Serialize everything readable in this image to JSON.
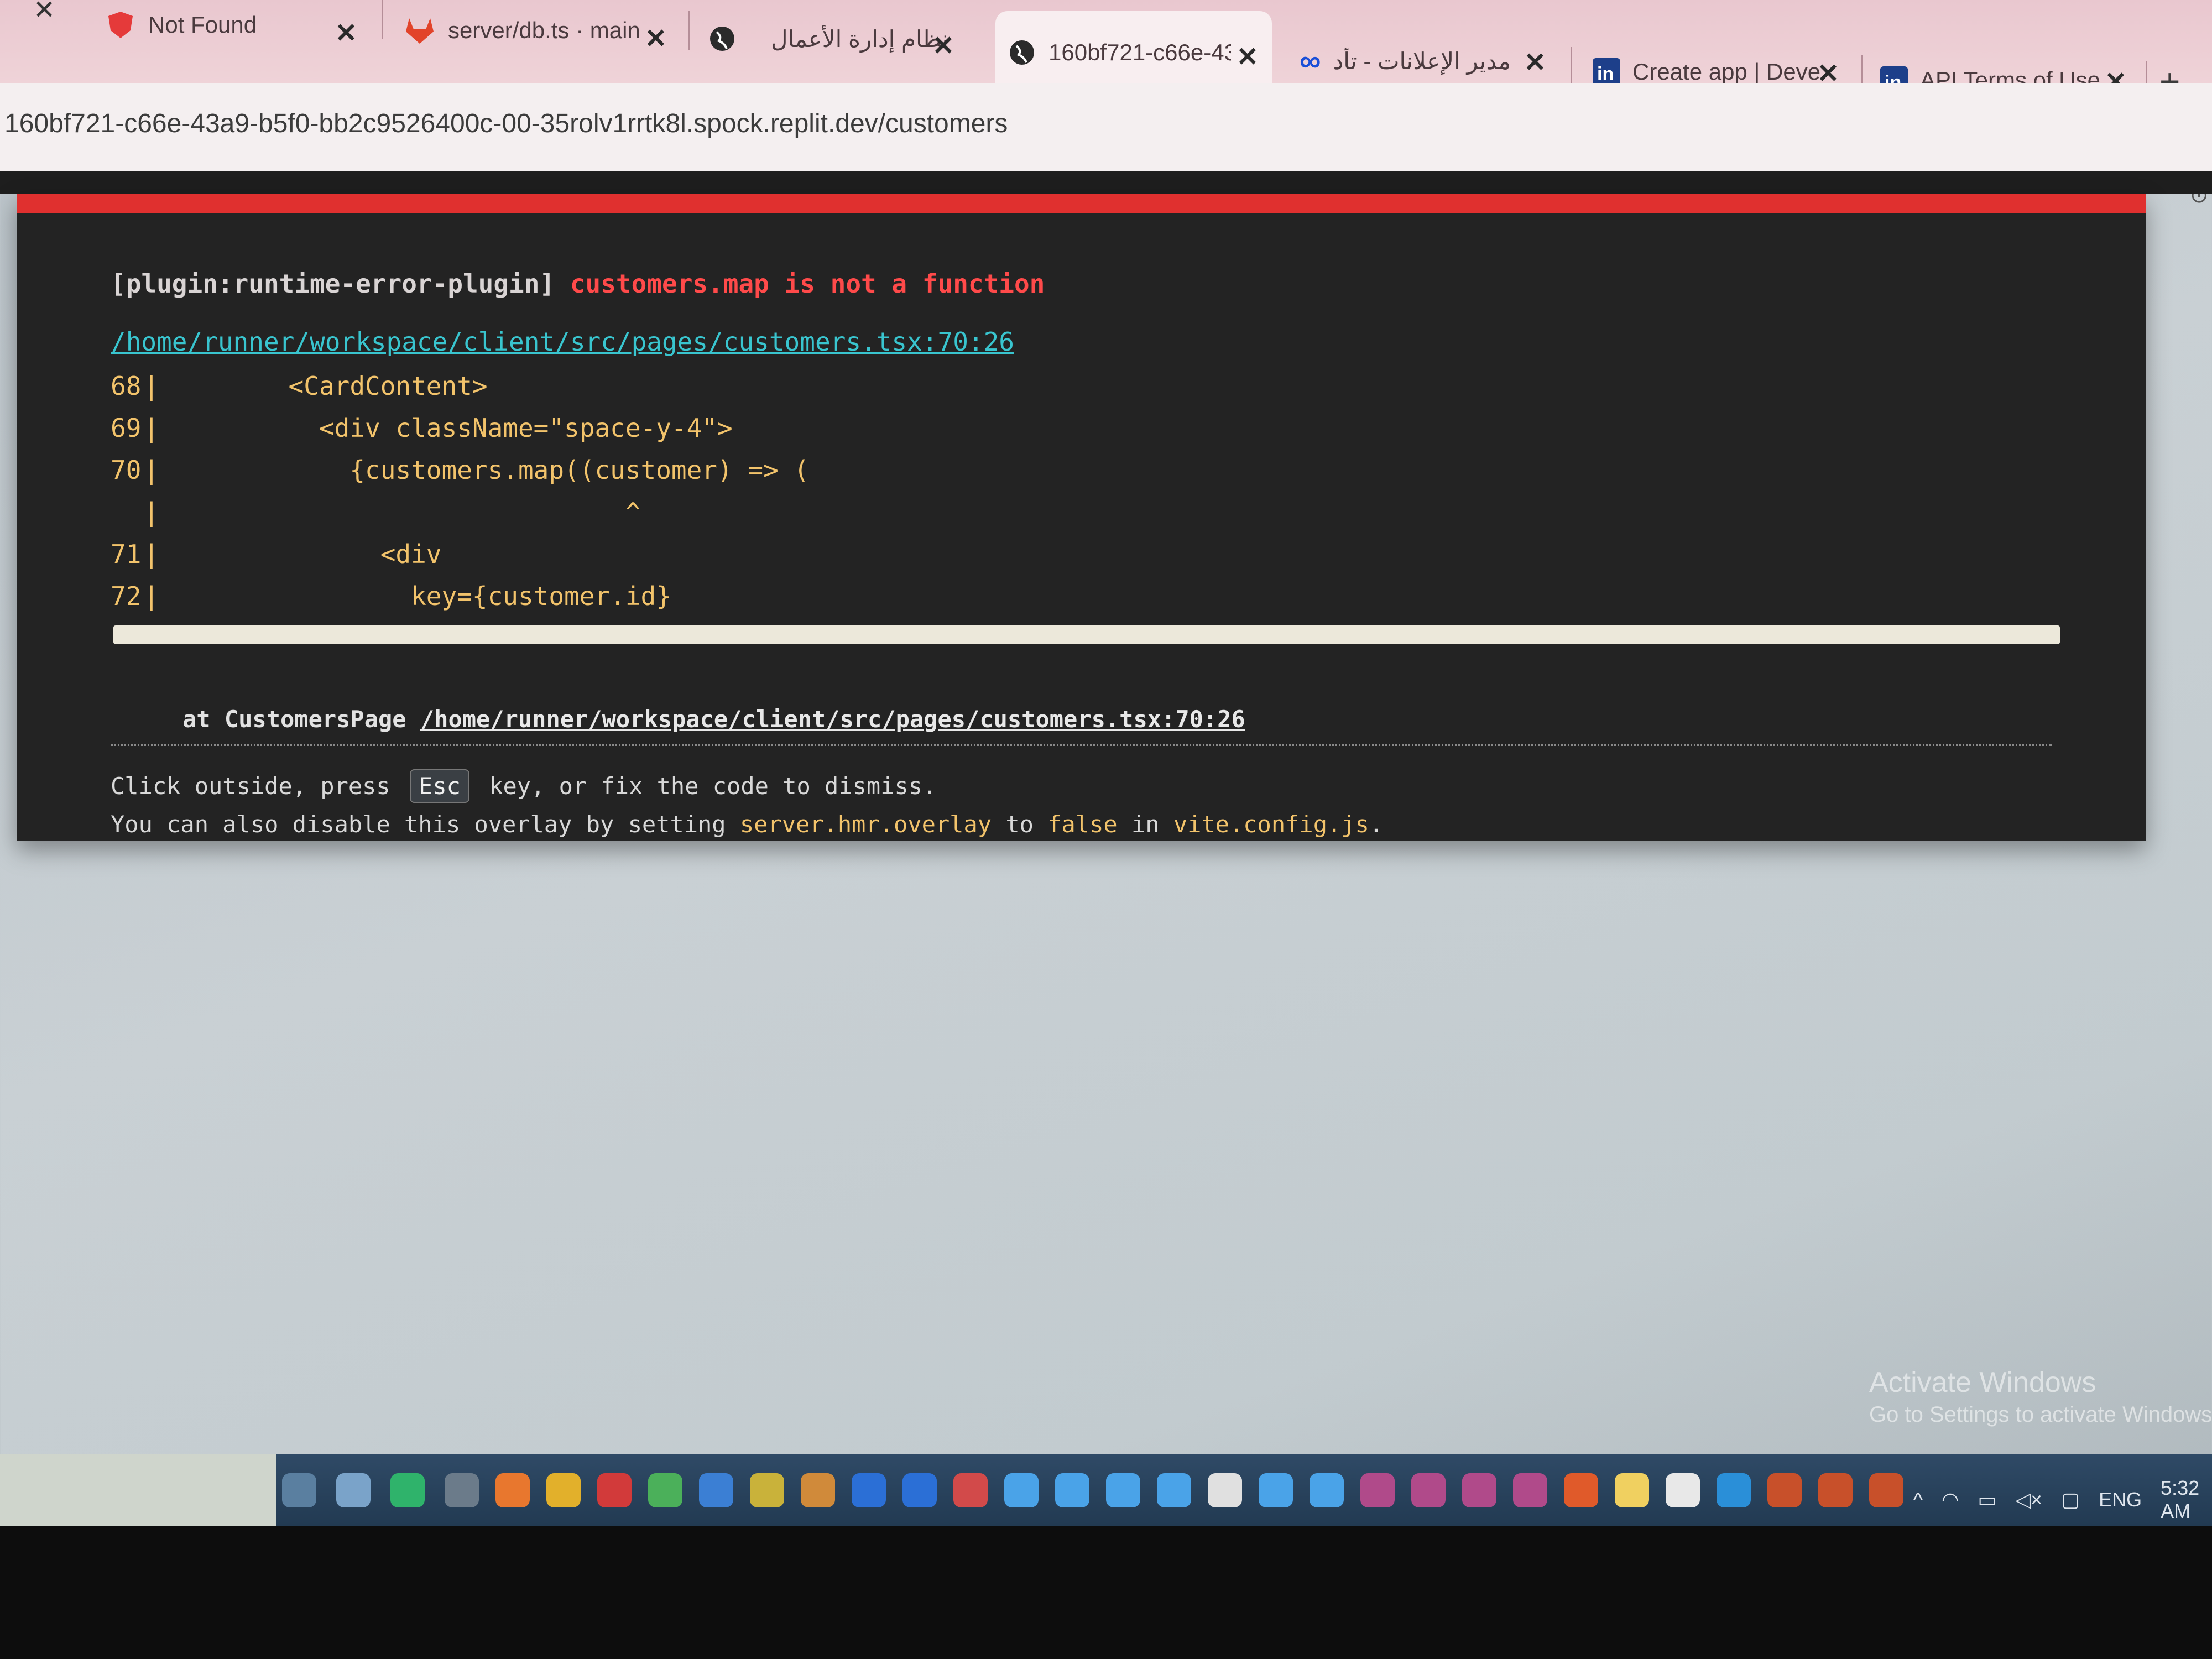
{
  "tabs": [
    {
      "title": "Not Found",
      "favicon": "red-shield-icon",
      "close": "✕"
    },
    {
      "title": "server/db.ts · main",
      "favicon": "gitlab-fox-icon",
      "close": "✕"
    },
    {
      "title": "نظام إدارة الأعمال",
      "favicon": "globe-icon",
      "close": "✕"
    },
    {
      "title": "160bf721-c66e-43",
      "favicon": "globe-icon",
      "close": "✕"
    },
    {
      "title": "مدير الإعلانات - تأد",
      "favicon": "meta-infinity-icon",
      "close": "✕"
    },
    {
      "title": "Create app | Deve",
      "favicon": "linkedin-icon",
      "close": "✕"
    },
    {
      "title": "API Terms of Use",
      "favicon": "linkedin-icon",
      "close": "✕"
    }
  ],
  "new_tab_label": "+",
  "address": {
    "url": "160bf721-c66e-43a9-b5f0-bb2c9526400c-00-35rolv1rrtk8l.spock.replit.dev/customers"
  },
  "error": {
    "plugin": "[plugin:runtime-error-plugin]",
    "message": "customers.map is not a function",
    "file": "/home/runner/workspace/client/src/pages/customers.tsx:70:26",
    "code_lines": [
      {
        "num": "68",
        "bar": "|",
        "code": "        <CardContent>"
      },
      {
        "num": "69",
        "bar": "|",
        "code": "          <div className=\"space-y-4\">"
      },
      {
        "num": "70",
        "bar": "|",
        "code": "            {customers.map((customer) => ("
      },
      {
        "num": "",
        "bar": "|",
        "code": "                              ^"
      },
      {
        "num": "71",
        "bar": "|",
        "code": "              <div"
      },
      {
        "num": "72",
        "bar": "|",
        "code": "                key={customer.id}"
      }
    ],
    "stack_prefix": "at CustomersPage",
    "stack_link": "/home/runner/workspace/client/src/pages/customers.tsx:70:26",
    "tip1_a": "Click outside, press",
    "tip1_key": "Esc",
    "tip1_b": "key, or fix the code to dismiss.",
    "tip2_a": "You can also disable this overlay by setting",
    "tip2_setting": "server.hmr.overlay",
    "tip2_b": "to",
    "tip2_value": "false",
    "tip2_c": "in",
    "tip2_file": "vite.config.js",
    "tip2_end": "."
  },
  "watermark": {
    "title": "Activate Windows",
    "subtitle": "Go to Settings to activate Windows."
  },
  "taskbar": {
    "icons": [
      "task-view-icon",
      "files-icon",
      "whatsapp-icon",
      "cmd-icon",
      "firefox-icon",
      "chrome-icon",
      "opera-icon",
      "chrome-profile-icon",
      "app-icon",
      "chrome-profile-2-icon",
      "chrome-profile-3-icon",
      "facebook-icon",
      "facebook-2-icon",
      "app-red-icon",
      "download-icon",
      "download-2-icon",
      "download-3-icon",
      "download-4-icon",
      "file-icon",
      "download-5-icon",
      "download-6-icon",
      "winrar-icon",
      "winrar-2-icon",
      "winrar-3-icon",
      "winrar-4-icon",
      "git-icon",
      "notes-icon",
      "cloud-icon",
      "vscode-icon",
      "app-red-2-icon",
      "app-red-3-icon",
      "app-red-4-icon"
    ],
    "tray_language": "ENG",
    "tray_time": "5:32 AM"
  }
}
